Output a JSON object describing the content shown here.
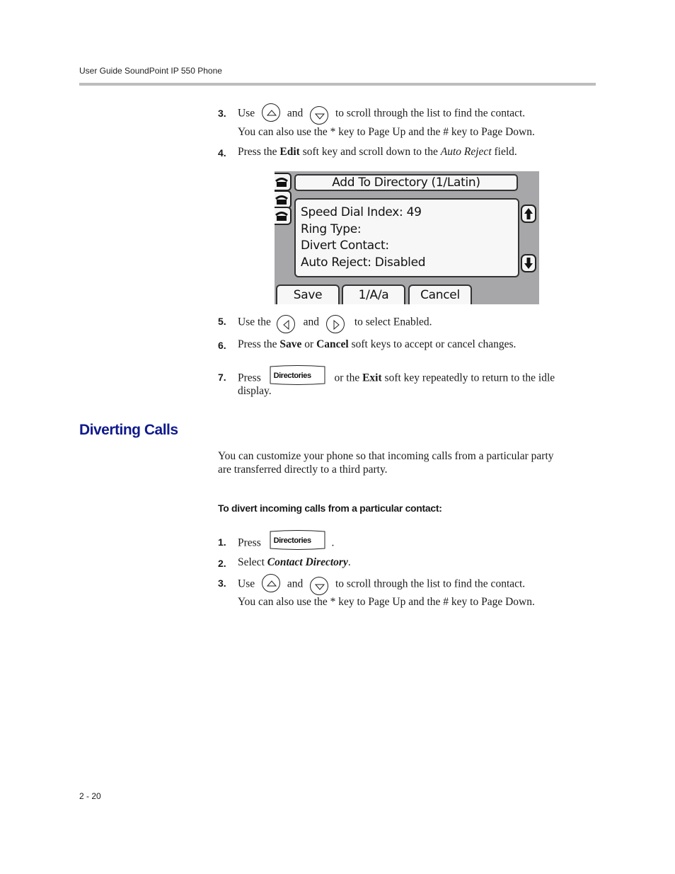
{
  "header": {
    "title": "User Guide SoundPoint IP 550 Phone"
  },
  "steps_top": [
    {
      "num": "3.",
      "pre": "Use",
      "mid": "and",
      "post": "to scroll through the list to find the contact.",
      "note": "You can also use the * key to Page Up and the # key to Page Down.",
      "icons": [
        "up-arrow-key",
        "down-arrow-key"
      ]
    },
    {
      "num": "4.",
      "pre": "Press the ",
      "bold": "Edit",
      "mid": " soft key and scroll down to the ",
      "italic": "Auto Reject",
      "post": " field."
    }
  ],
  "phone_screen": {
    "title": "Add To Directory (1/Latin)",
    "fields": [
      "Speed Dial Index: 49",
      "Ring Type:",
      "Divert Contact:",
      "Auto Reject: Disabled"
    ],
    "softkeys": [
      "Save",
      "1/A/a",
      "Cancel"
    ],
    "line_icons": [
      "phone-line-icon",
      "phone-line-icon",
      "phone-line-icon"
    ],
    "scroll_icons": [
      "scroll-up-icon",
      "scroll-down-icon"
    ],
    "colors": {
      "background": "#a7a7a9",
      "panel": "#f7f7f7"
    }
  },
  "steps_mid": [
    {
      "num": "5.",
      "pre": "Use the",
      "mid": "and",
      "post": "to select Enabled.",
      "icons": [
        "left-arrow-key",
        "right-arrow-key"
      ]
    },
    {
      "num": "6.",
      "pre": "Press the ",
      "bold1": "Save",
      "mid": " or ",
      "bold2": "Cancel",
      "post": " soft keys to accept or cancel changes."
    },
    {
      "num": "7.",
      "pre": "Press",
      "key_label": "Directories",
      "mid": "or the ",
      "bold": "Exit",
      "post": " soft key repeatedly to return to the idle",
      "cont": "display."
    }
  ],
  "section": {
    "title": "Diverting Calls",
    "title_color": "#101a8c",
    "intro_lines": [
      "You can customize your phone so that incoming calls from a particular party",
      "are transferred directly to a third party."
    ],
    "procedure_title": "To divert incoming calls from a particular contact:",
    "steps": [
      {
        "num": "1.",
        "pre": "Press",
        "key_label": "Directories",
        "post": "."
      },
      {
        "num": "2.",
        "pre": "Select ",
        "bold_italic": "Contact Directory",
        "post": "."
      },
      {
        "num": "3.",
        "pre": "Use",
        "mid": "and",
        "post": "to scroll through the list to find the contact.",
        "note": "You can also use the * key to Page Up and the # key to Page Down."
      }
    ]
  },
  "footer": {
    "page_number": "2 - 20"
  }
}
